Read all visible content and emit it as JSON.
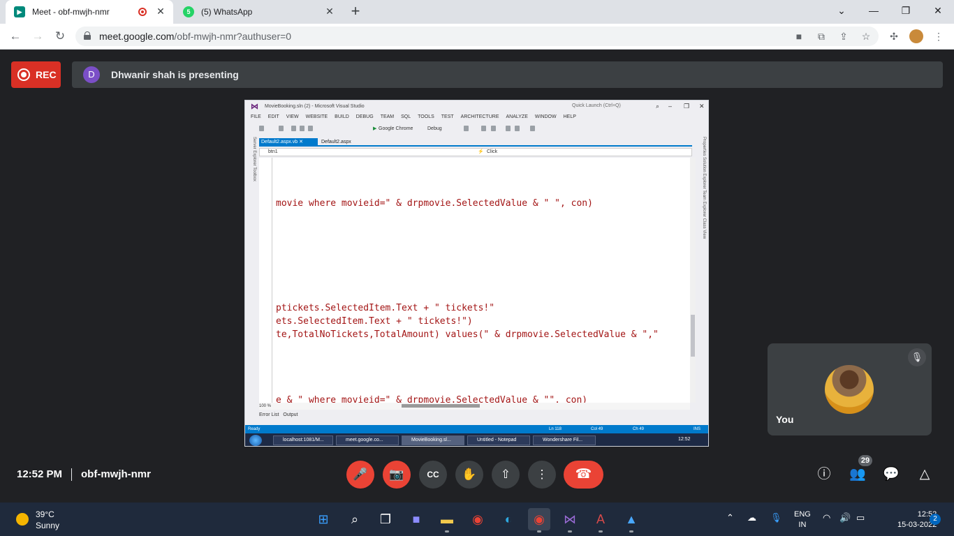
{
  "browser": {
    "tabs": [
      {
        "title": "Meet - obf-mwjh-nmr",
        "recording": true
      },
      {
        "title": "(5) WhatsApp"
      }
    ],
    "url_host": "meet.google.com",
    "url_path": "/obf-mwjh-nmr?authuser=0"
  },
  "meet": {
    "rec_label": "REC",
    "presenter_initial": "D",
    "presenting_text": "Dhwanir shah is presenting",
    "time": "12:52 PM",
    "meeting_code": "obf-mwjh-nmr",
    "participants_count": "29",
    "self_label": "You"
  },
  "shared_screen": {
    "window_title": "MovieBooking.sln (2) - Microsoft Visual Studio",
    "quick_launch": "Quick Launch (Ctrl+Q)",
    "menu": [
      "FILE",
      "EDIT",
      "VIEW",
      "WEBSITE",
      "BUILD",
      "DEBUG",
      "TEAM",
      "SQL",
      "TOOLS",
      "TEST",
      "ARCHITECTURE",
      "ANALYZE",
      "WINDOW",
      "HELP"
    ],
    "run_target": "Google Chrome",
    "config": "Debug",
    "left_panels": "Server Explorer   Toolbox",
    "right_panels": "Properties   Solution Explorer   Team Explorer   Class View",
    "doc_tabs": [
      "Default2.aspx.vb",
      "Default2.aspx"
    ],
    "nav_left": "btn1",
    "nav_right": "Click",
    "code_lines": [
      {
        "text": "movie where movieid=\" & drpmovie.SelectedValue & \" \", con)"
      },
      {
        "text": "ptickets.SelectedItem.Text + \" tickets!\""
      },
      {
        "text": "ets.SelectedItem.Text + \" tickets!\")"
      },
      {
        "text": "te,TotalNoTickets,TotalAmount) values(\" & drpmovie.SelectedValue & \",\""
      },
      {
        "text": "e & \" where movieid=\" & drpmovie.SelectedValue & \"\", con)"
      }
    ],
    "zoom": "100 %",
    "bottom_tabs": [
      "Error List",
      "Output"
    ],
    "status": {
      "ready": "Ready",
      "ln": "Ln 118",
      "col": "Col 49",
      "ch": "Ch 49",
      "ins": "INS"
    },
    "taskbar_items": [
      "localhost:1081/M...",
      "meet.google.co...",
      "MovieBooking.sl...",
      "Untitled - Notepad",
      "Wondershare Fil..."
    ],
    "clock": "12:52"
  },
  "taskbar": {
    "weather_temp": "39°C",
    "weather_cond": "Sunny",
    "lang_top": "ENG",
    "lang_bottom": "IN",
    "time": "12:52",
    "date": "15-03-2022",
    "notifications": "2"
  },
  "colors": {
    "accent_red": "#ea4335",
    "vs_blue": "#007acc",
    "meet_bg": "#202124"
  }
}
